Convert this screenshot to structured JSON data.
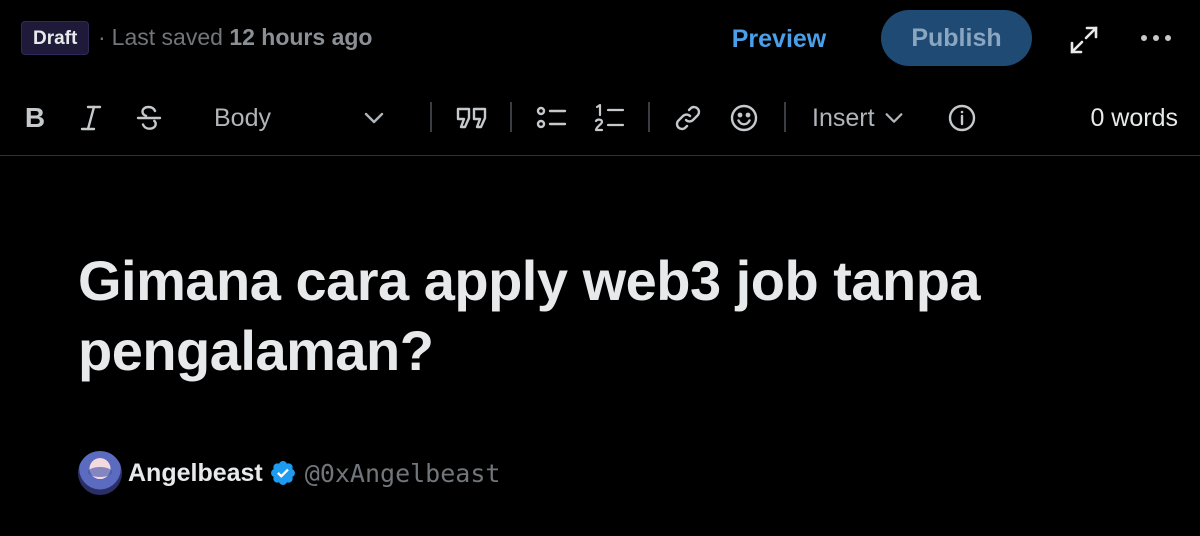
{
  "header": {
    "draft_badge": "Draft",
    "separator": "·",
    "save_prefix": "Last saved",
    "save_time": "12 hours ago",
    "preview_label": "Preview",
    "publish_label": "Publish"
  },
  "toolbar": {
    "bold_label": "B",
    "text_style": "Body",
    "insert_label": "Insert",
    "word_count": "0 words"
  },
  "article": {
    "title": "Gimana cara apply web3 job tanpa pengalaman?",
    "author_name": "Angelbeast",
    "author_handle": "@0xAngelbeast"
  },
  "colors": {
    "background": "#000000",
    "accent": "#1d9bf0",
    "publish_disabled_bg": "#1e4a74",
    "muted_text": "#71767b"
  },
  "icons": [
    "italic-icon",
    "strikethrough-icon",
    "chevron-down-icon",
    "quote-icon",
    "bullet-list-icon",
    "numbered-list-icon",
    "link-icon",
    "emoji-icon",
    "info-icon",
    "expand-icon",
    "more-icon",
    "verified-badge-icon"
  ]
}
